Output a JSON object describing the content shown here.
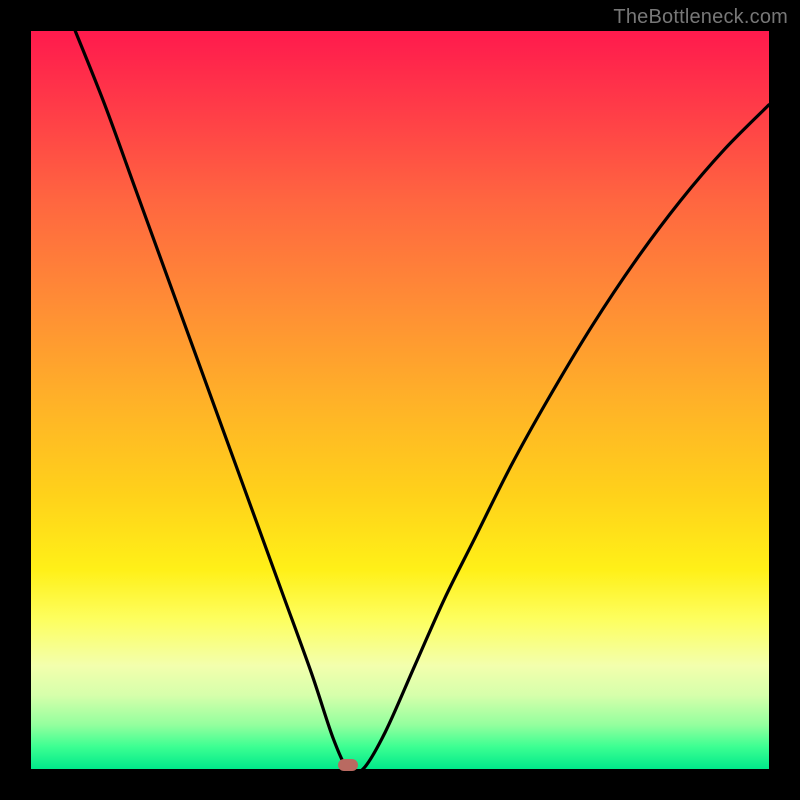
{
  "watermark": "TheBottleneck.com",
  "colors": {
    "frame": "#000000",
    "curve": "#000000",
    "marker": "#b96a61"
  },
  "chart_data": {
    "type": "line",
    "title": "",
    "xlabel": "",
    "ylabel": "",
    "xlim": [
      0,
      100
    ],
    "ylim": [
      0,
      100
    ],
    "grid": false,
    "legend": false,
    "annotations": [
      {
        "name": "optimal-marker",
        "x": 43,
        "y": 0.5
      }
    ],
    "series": [
      {
        "name": "bottleneck-curve",
        "x": [
          6,
          10,
          14,
          18,
          22,
          26,
          30,
          34,
          38,
          41,
          43,
          45,
          48,
          52,
          56,
          60,
          65,
          70,
          76,
          82,
          88,
          94,
          100
        ],
        "y": [
          100,
          90,
          79,
          68,
          57,
          46,
          35,
          24,
          13,
          4,
          0,
          0,
          5,
          14,
          23,
          31,
          41,
          50,
          60,
          69,
          77,
          84,
          90
        ]
      }
    ],
    "background_gradient": {
      "type": "vertical",
      "stops": [
        {
          "pos": 0,
          "color": "#ff1a4d"
        },
        {
          "pos": 50,
          "color": "#ffb128"
        },
        {
          "pos": 75,
          "color": "#fff018"
        },
        {
          "pos": 100,
          "color": "#00e98a"
        }
      ]
    }
  }
}
